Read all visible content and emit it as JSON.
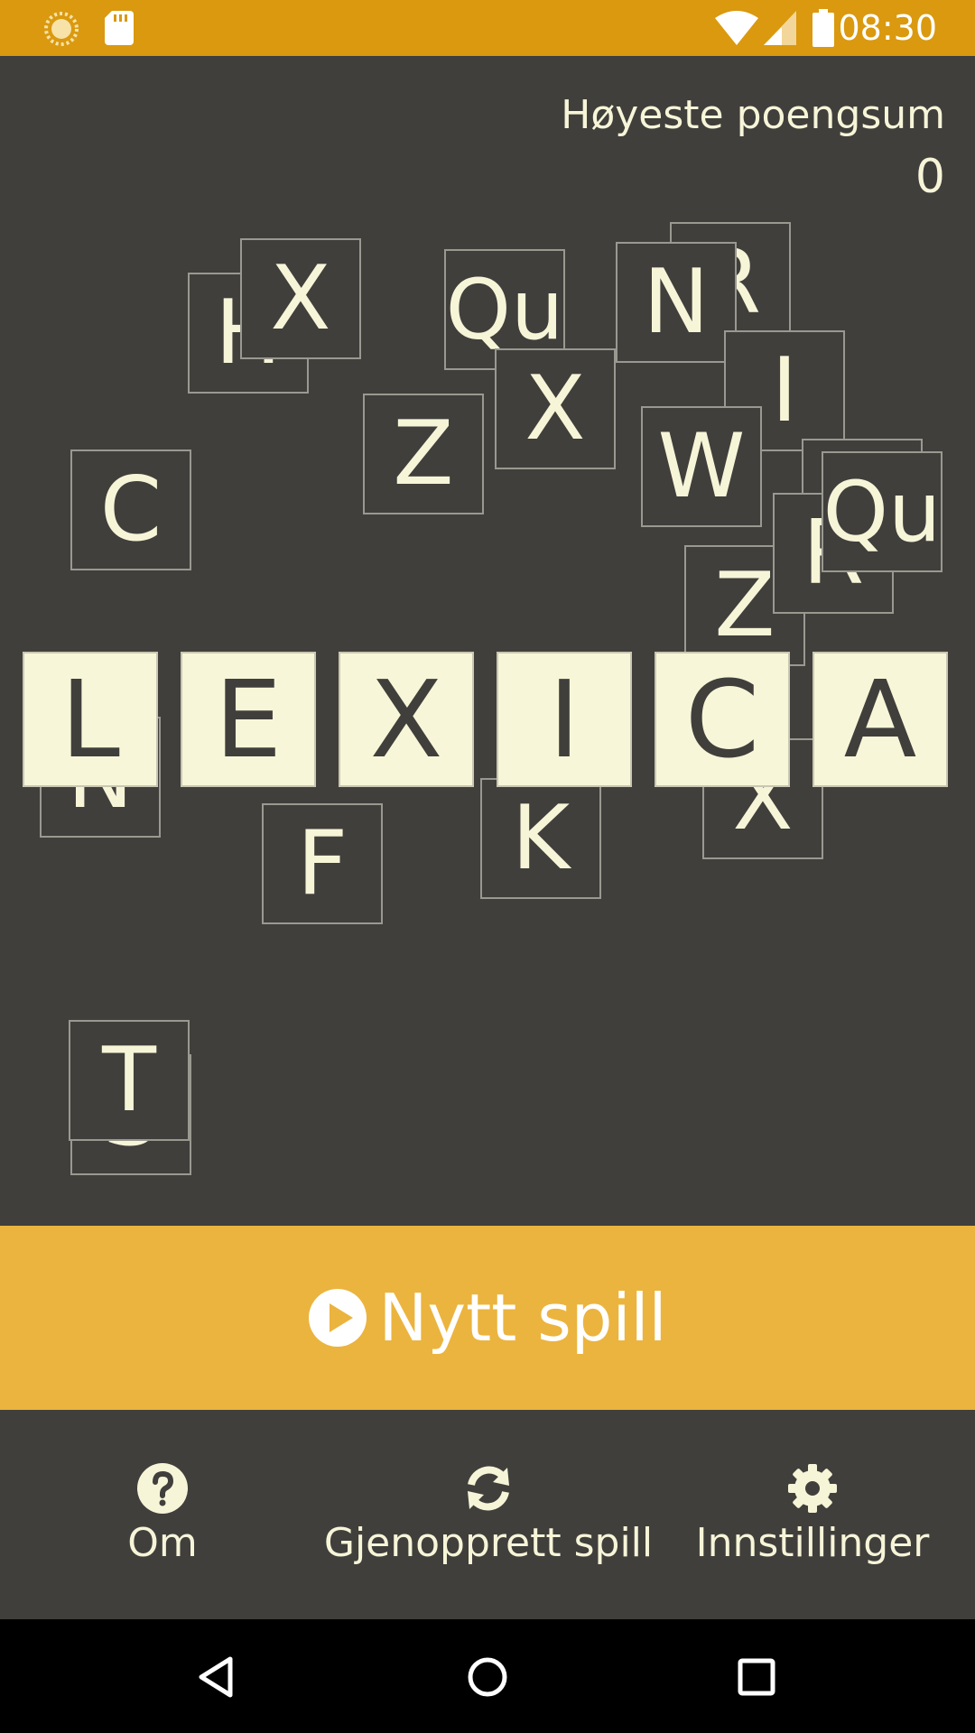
{
  "status": {
    "time": "08:30",
    "color_bar": "#da990f"
  },
  "score": {
    "label": "Høyeste poengsum",
    "value": "0"
  },
  "tiles": [
    "H",
    "X",
    "Qu",
    "R",
    "N",
    "Z",
    "X",
    "I",
    "C",
    "W",
    "K",
    "Qu",
    "Z",
    "R",
    "N",
    "X",
    "F",
    "K",
    "T",
    "S"
  ],
  "title_tiles": [
    "L",
    "E",
    "X",
    "I",
    "C",
    "A"
  ],
  "new_game": {
    "label": "Nytt spill",
    "icon": "play-circle-icon",
    "color": "#ebb43e"
  },
  "options": {
    "about": {
      "label": "Om",
      "icon": "help-circle-icon"
    },
    "restore": {
      "label": "Gjenopprett spill",
      "icon": "refresh-icon"
    },
    "settings": {
      "label": "Innstillinger",
      "icon": "gear-icon"
    }
  },
  "colors": {
    "background": "#403f3c",
    "tile_text": "#f7f5d8"
  }
}
